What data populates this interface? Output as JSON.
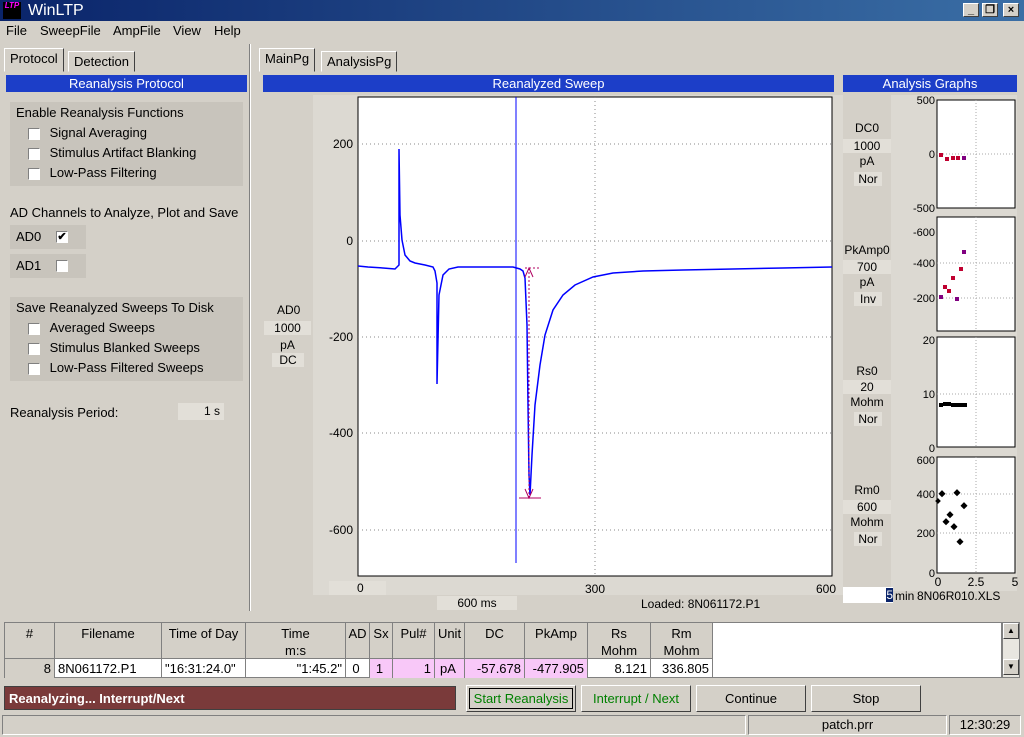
{
  "window": {
    "title": "WinLTP",
    "logo": "LTP"
  },
  "menu": [
    "File",
    "SweepFile",
    "AmpFile",
    "View",
    "Help"
  ],
  "left_tabs": [
    "Protocol",
    "Detection"
  ],
  "main_tabs": [
    "MainPg",
    "AnalysisPg"
  ],
  "protocol": {
    "header": "Reanalysis Protocol",
    "enable_title": "Enable Reanalysis Functions",
    "enable_items": [
      "Signal Averaging",
      "Stimulus Artifact Blanking",
      "Low-Pass Filtering"
    ],
    "ad_title": "AD Channels to Analyze, Plot and Save",
    "ad0_label": "AD0",
    "ad0_checked": true,
    "ad1_label": "AD1",
    "ad1_checked": false,
    "save_title": "Save Reanalyzed Sweeps To Disk",
    "save_items": [
      "Averaged Sweeps",
      "Stimulus Blanked Sweeps",
      "Low-Pass Filtered Sweeps"
    ],
    "period_label": "Reanalysis Period:",
    "period_value": "1 s"
  },
  "sweep": {
    "header": "Reanalyzed Sweep",
    "channel": "AD0",
    "scale": "1000",
    "unit": "pA",
    "coupling": "DC",
    "y_ticks": [
      "200",
      "0",
      "-200",
      "-400",
      "-600"
    ],
    "x_ticks": [
      "0",
      "300",
      "600"
    ],
    "x_start": "0",
    "x_span": "600 ms",
    "loaded": "Loaded: 8N061172.P1"
  },
  "analysis": {
    "header": "Analysis Graphs",
    "graphs": [
      {
        "name": "DC0",
        "scale": "1000",
        "unit": "pA",
        "mode": "Nor",
        "ticks": [
          "500",
          "0",
          "-500"
        ]
      },
      {
        "name": "PkAmp0",
        "scale": "700",
        "unit": "pA",
        "mode": "Inv",
        "ticks": [
          "-600",
          "-400",
          "-200"
        ]
      },
      {
        "name": "Rs0",
        "scale": "20",
        "unit": "Mohm",
        "mode": "Nor",
        "ticks": [
          "20",
          "10",
          "0"
        ]
      },
      {
        "name": "Rm0",
        "scale": "600",
        "unit": "Mohm",
        "mode": "Nor",
        "ticks": [
          "600",
          "400",
          "200",
          "0"
        ]
      }
    ],
    "x_ticks": [
      "0",
      "2.5",
      "5"
    ],
    "time_value": "5",
    "time_unit": "min",
    "xls_file": "8N06R010.XLS"
  },
  "table": {
    "headers": [
      "#",
      "Filename",
      "Time of Day",
      "Time",
      "AD",
      "Sx",
      "Pul#",
      "Unit",
      "DC",
      "PkAmp",
      "Rs",
      "Rm"
    ],
    "subheaders": [
      "",
      "",
      "",
      "m:s",
      "",
      "",
      "",
      "",
      "",
      "",
      "Mohm",
      "Mohm"
    ],
    "row": [
      "8",
      "8N061172.P1",
      "\"16:31:24.0\"",
      "\"1:45.2\"",
      "0",
      "1",
      "1",
      "pA",
      "-57.678",
      "-477.905",
      "8.121",
      "336.805"
    ]
  },
  "status_message": "Reanalyzing... Interrupt/Next",
  "buttons": {
    "start": "Start Reanalysis",
    "interrupt": "Interrupt / Next",
    "continue": "Continue",
    "stop": "Stop"
  },
  "statusbar": {
    "protocol": "patch.prr",
    "time": "12:30:29"
  },
  "colors": {
    "title_bar": "#0a246a",
    "header_blue": "#1c3ec8",
    "trace": "#0000ff",
    "marker": "#c00040",
    "status_bg": "#7a3a3a",
    "green_text": "#008000"
  }
}
